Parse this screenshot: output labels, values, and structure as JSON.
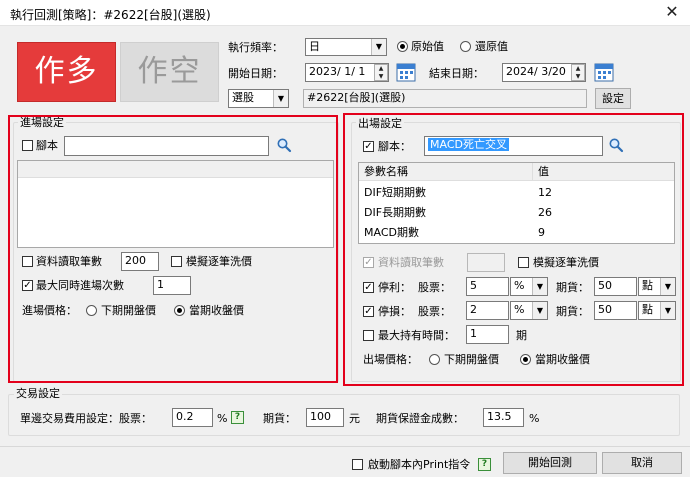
{
  "window": {
    "title": "執行回測[策略]：#2622[台股](選股)",
    "close_glyph": "✕"
  },
  "mode_buttons": {
    "long": "作多",
    "short": "作空"
  },
  "top": {
    "freq_label": "執行頻率：",
    "freq_value": "日",
    "price_original": "原始值",
    "price_restored": "還原值",
    "start_label": "開始日期：",
    "start_date": "2023/ 1/ 1",
    "end_label": "結束日期：",
    "end_date": "2024/ 3/20",
    "scope_value": "選股",
    "scope_target": "#2622[台股](選股)",
    "settings_button": "設定"
  },
  "entry": {
    "group_title": "進場設定",
    "script_label": "腳本",
    "script_value": "",
    "read_bars_label": "資料讀取筆數",
    "read_bars_value": "200",
    "simulate_wash_label": "模擬逐筆洗價",
    "max_entries_label": "最大同時進場次數",
    "max_entries_value": "1",
    "price_label": "進場價格：",
    "price_next_open": "下期開盤價",
    "price_this_close": "當期收盤價"
  },
  "exit": {
    "group_title": "出場設定",
    "script_label": "腳本：",
    "script_value": "MACD死亡交叉",
    "table": {
      "headers": [
        "參數名稱",
        "值"
      ],
      "rows": [
        {
          "name": "DIF短期期數",
          "value": "12"
        },
        {
          "name": "DIF長期期數",
          "value": "26"
        },
        {
          "name": "MACD期數",
          "value": "9"
        }
      ]
    },
    "read_bars_label": "資料讀取筆數",
    "simulate_wash_label": "模擬逐筆洗價",
    "take_profit_label": "停利：",
    "stop_loss_label": "停損：",
    "stock_label": "股票：",
    "futures_label": "期貨：",
    "take_profit_stock": "5",
    "take_profit_stock_unit": "%",
    "take_profit_futures": "50",
    "take_profit_futures_unit": "點",
    "stop_loss_stock": "2",
    "stop_loss_stock_unit": "%",
    "stop_loss_futures": "50",
    "stop_loss_futures_unit": "點",
    "max_hold_label": "最大持有時間：",
    "max_hold_value": "1",
    "max_hold_unit": "期",
    "price_label": "出場價格：",
    "price_next_open": "下期開盤價",
    "price_this_close": "當期收盤價"
  },
  "trade": {
    "group_title": "交易設定",
    "fee_label": "單邊交易費用設定：股票：",
    "fee_stock": "0.2",
    "fee_stock_unit": "%",
    "futures_label": "期貨：",
    "fee_futures": "100",
    "fee_futures_unit": "元",
    "margin_label": "期貨保證金成數：",
    "margin_value": "13.5",
    "margin_unit": "%"
  },
  "footer": {
    "print_label": "啟動腳本內Print指令",
    "start_button": "開始回測",
    "cancel_button": "取消"
  },
  "check_glyph": "✓",
  "help_glyph": "?",
  "colors": {
    "long": "#e33b3b",
    "short": "#dadada",
    "highlight": "#3399ff",
    "accent_red": "#e3001b"
  }
}
